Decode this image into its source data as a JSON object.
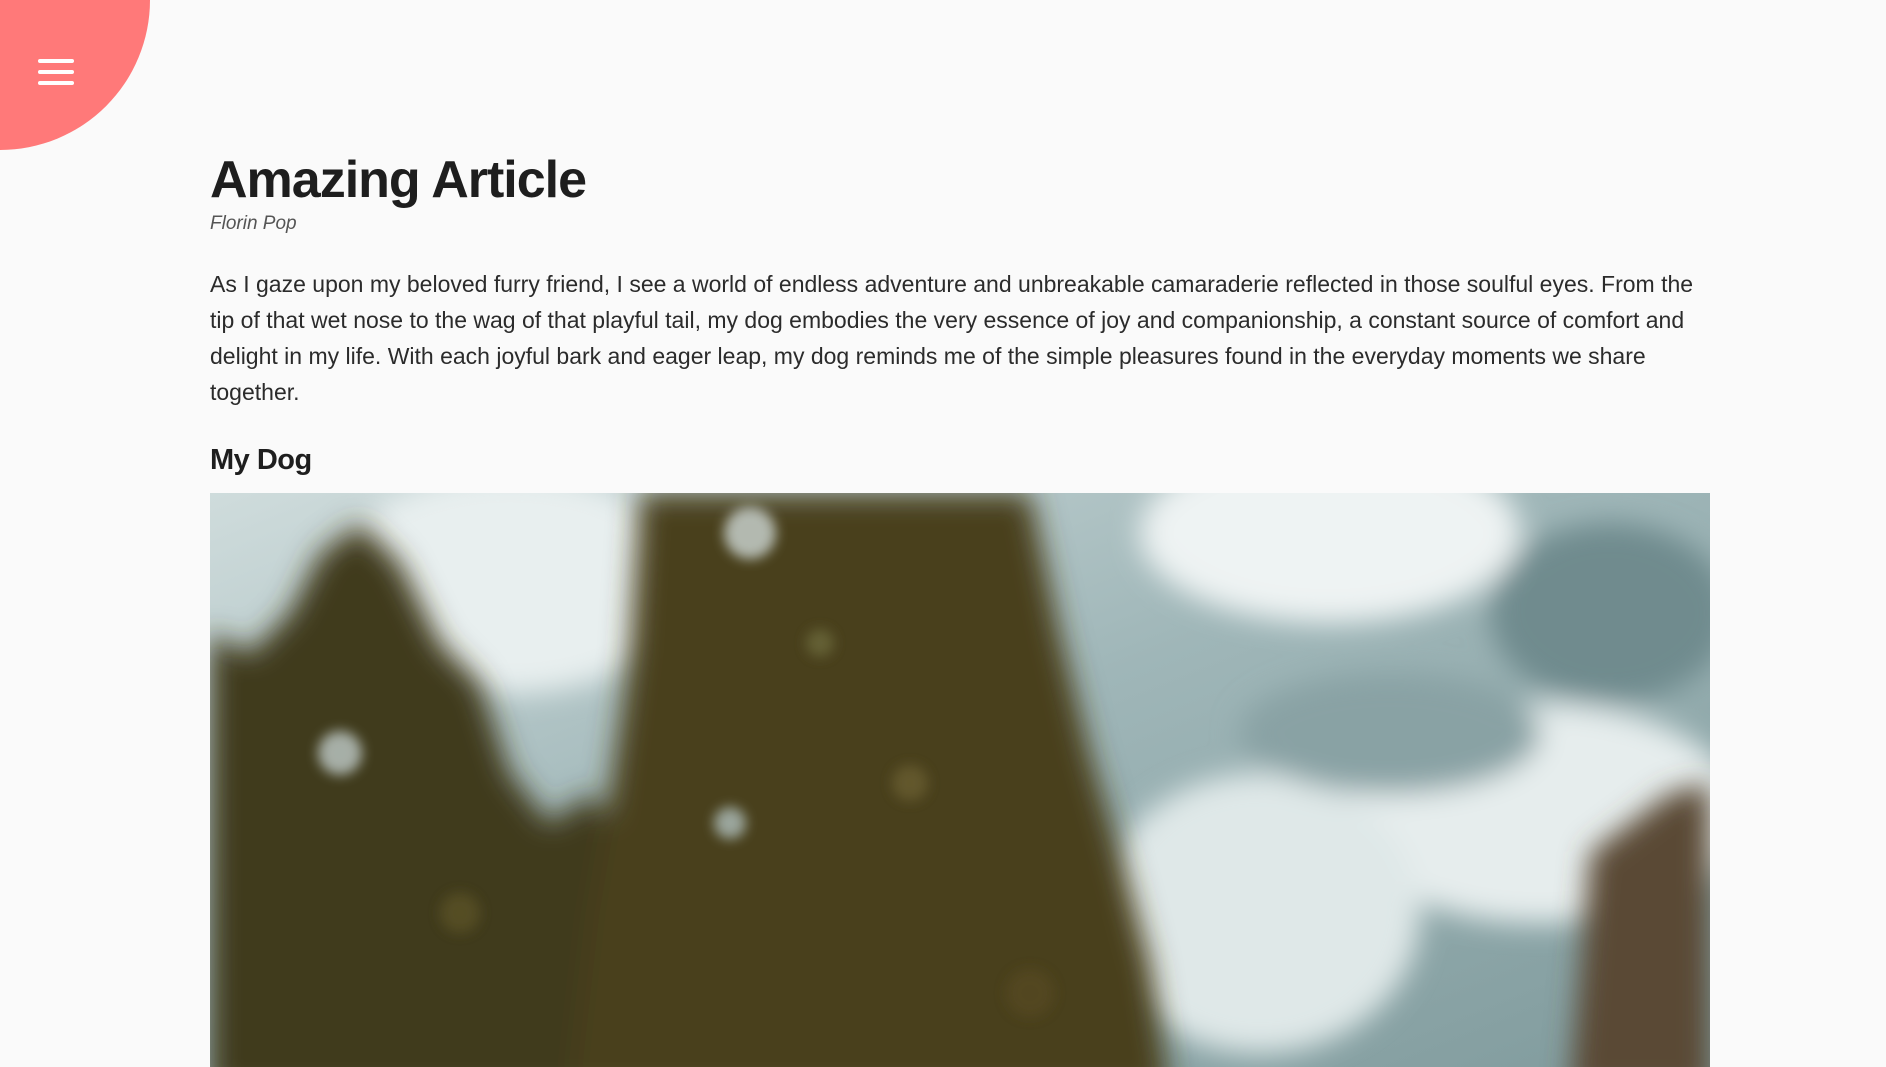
{
  "menu": {
    "accent_color": "#ff7979",
    "icon": "hamburger-menu-icon"
  },
  "article": {
    "title": "Amazing Article",
    "author": "Florin Pop",
    "body": "As I gaze upon my beloved furry friend, I see a world of endless adventure and unbreakable camaraderie reflected in those soulful eyes. From the tip of that wet nose to the wag of that playful tail, my dog embodies the very essence of joy and companionship, a constant source of comfort and delight in my life. With each joyful bark and eager leap, my dog reminds me of the simple pleasures found in the everyday moments we share together.",
    "subheading": "My Dog"
  }
}
